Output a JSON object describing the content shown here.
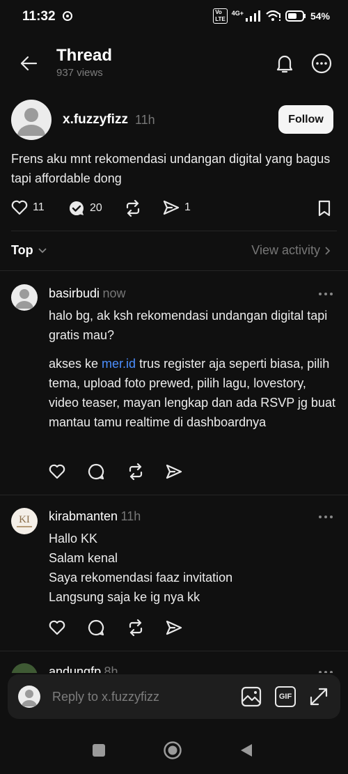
{
  "status": {
    "time": "11:32",
    "network": "4G+",
    "battery": "54%"
  },
  "header": {
    "title": "Thread",
    "views": "937 views"
  },
  "op": {
    "username": "x.fuzzyfizz",
    "time": "11h",
    "follow_label": "Follow",
    "text": "Frens aku mnt rekomendasi undangan digital yang bagus tapi affordable dong",
    "likes": "11",
    "reposts": "20",
    "shares": "1"
  },
  "sort": {
    "label": "Top",
    "view_activity": "View activity"
  },
  "replies": [
    {
      "username": "basirbudi",
      "time": "now",
      "p1": "halo bg, ak ksh rekomendasi undangan digital tapi gratis mau?",
      "p2_before": "akses ke ",
      "p2_link": "mer.id",
      "p2_after": " trus register aja seperti biasa, pilih tema, upload foto prewed, pilih lagu, lovestory, video teaser, mayan lengkap dan ada RSVP jg buat mantau tamu realtime di dashboardnya"
    },
    {
      "username": "kirabmanten",
      "time": "11h",
      "avatar_text": "KI",
      "lines": [
        "Hallo KK",
        "Salam kenal",
        "Saya rekomendasi faaz invitation",
        "Langsung saja ke ig nya kk"
      ]
    },
    {
      "username": "andungfp",
      "time": "8h"
    }
  ],
  "composer": {
    "placeholder": "Reply to x.fuzzyfizz",
    "gif_label": "GIF"
  },
  "colors": {
    "background": "#101010",
    "link": "#4c8fff",
    "follow_bg": "#f5f5f5"
  }
}
